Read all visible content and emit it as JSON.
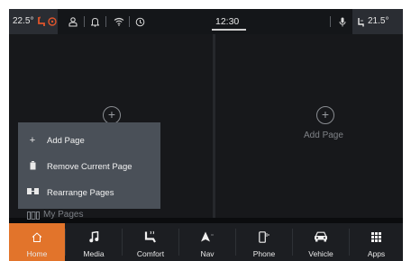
{
  "status_bar": {
    "left_temp": "22.5°",
    "clock": "12:30",
    "right_temp": "21.5°",
    "icons": [
      "heated-seat-icon",
      "steering-wheel-heat-icon",
      "user-icon",
      "bell-icon",
      "wifi-icon",
      "timer-icon",
      "microphone-icon",
      "seat-icon"
    ]
  },
  "pages": {
    "left": {
      "icon": "add-circle-icon"
    },
    "right": {
      "icon": "add-circle-icon",
      "label": "Add Page"
    }
  },
  "menu": {
    "items": [
      {
        "icon": "plus-icon",
        "glyph": "+",
        "label": "Add Page"
      },
      {
        "icon": "trash-icon",
        "glyph": "■",
        "label": "Remove Current Page"
      },
      {
        "icon": "rearrange-icon",
        "glyph": "⇆",
        "label": "Rearrange Pages"
      }
    ]
  },
  "my_pages": {
    "label": "My Pages"
  },
  "nav": {
    "items": [
      {
        "key": "home",
        "label": "Home",
        "icon": "home-icon"
      },
      {
        "key": "media",
        "label": "Media",
        "icon": "music-note-icon"
      },
      {
        "key": "comfort",
        "label": "Comfort",
        "icon": "comfort-seat-icon"
      },
      {
        "key": "nav",
        "label": "Nav",
        "icon": "navigation-arrow-icon"
      },
      {
        "key": "phone",
        "label": "Phone",
        "icon": "phone-icon"
      },
      {
        "key": "vehicle",
        "label": "Vehicle",
        "icon": "car-icon"
      },
      {
        "key": "apps",
        "label": "Apps",
        "icon": "grid-icon"
      }
    ],
    "active": "home"
  },
  "colors": {
    "accent": "#e2742b",
    "background": "#0b0c0e",
    "panel": "#17181b",
    "menu": "#4a5058"
  }
}
